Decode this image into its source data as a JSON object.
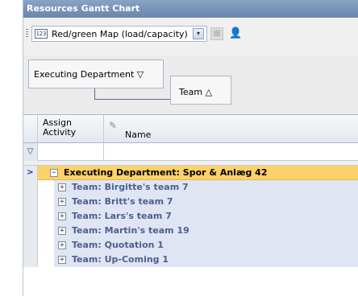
{
  "panel": {
    "title": "Resources Gantt Chart"
  },
  "toolbar": {
    "map_icon_text": "123",
    "map_select_value": "Red/green Map (load/capacity)",
    "dropdown_glyph": "▾",
    "disabled_tool_icon": "gray-tool-icon",
    "resource_icon": "person-icon"
  },
  "grouping": {
    "fields": [
      {
        "label": "Executing Department ▽"
      },
      {
        "label": "Team △"
      }
    ]
  },
  "grid": {
    "columns": {
      "assign_activity": "Assign Activity",
      "name": "Name"
    },
    "filter_glyph": "▽",
    "current_row_glyph": ">",
    "expander_glyph": "⊟",
    "collapsed_glyph": "⊞",
    "department_group": {
      "label": "Executing Department: Spor & Anlæg 42"
    },
    "team_groups": [
      {
        "label": "Team: Birgitte's team 7"
      },
      {
        "label": "Team: Britt's team 7"
      },
      {
        "label": "Team: Lars's team 7"
      },
      {
        "label": "Team: Martin's team 19"
      },
      {
        "label": "Team: Quotation  1"
      },
      {
        "label": "Team: Up-Coming 1"
      }
    ]
  }
}
